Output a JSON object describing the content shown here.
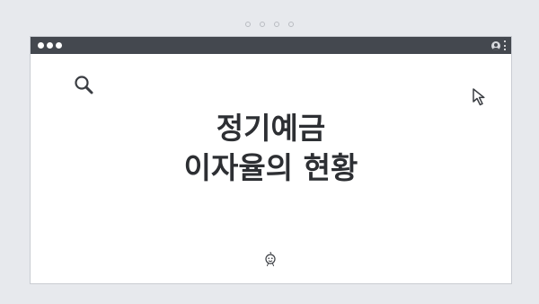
{
  "window": {
    "heading_line1": "정기예금",
    "heading_line2": "이자율의 현황"
  },
  "icons": {
    "search": "search-icon",
    "cursor": "cursor-arrow-icon",
    "face": "smiley-face-icon",
    "profile": "profile-icon",
    "menu": "kebab-menu-icon"
  },
  "colors": {
    "titlebar": "#44484f",
    "background": "#e7e9ed",
    "heading": "#2d2f33"
  }
}
